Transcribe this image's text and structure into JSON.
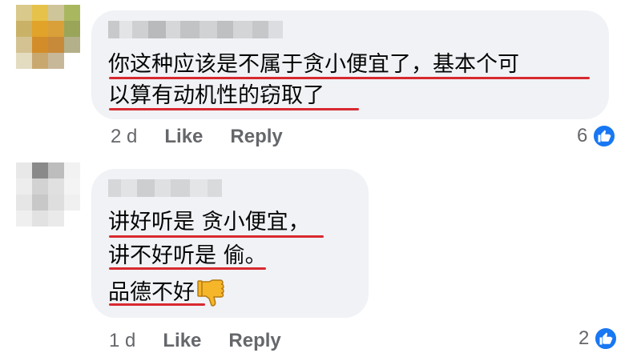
{
  "comments": [
    {
      "author": "",
      "lines": [
        "你这种应该是不属于贪小便宜了，基本个可",
        "以算有动机性的窃取了"
      ],
      "time": "2 d",
      "like_label": "Like",
      "reply_label": "Reply",
      "reaction_count": "6",
      "reaction_icon": "thumbs-up-icon"
    },
    {
      "author": "",
      "lines": [
        "讲好听是  贪小便宜，",
        "讲不好听是 偷。",
        "品德不好"
      ],
      "emoji": "thumbs-down-emoji",
      "time": "1 d",
      "like_label": "Like",
      "reply_label": "Reply",
      "reaction_count": "2",
      "reaction_icon": "thumbs-up-icon"
    }
  ],
  "colors": {
    "bubble": "#f0f2f5",
    "underline": "#d8292f",
    "meta_text": "#65676b",
    "like_blue": "#1877f2"
  }
}
